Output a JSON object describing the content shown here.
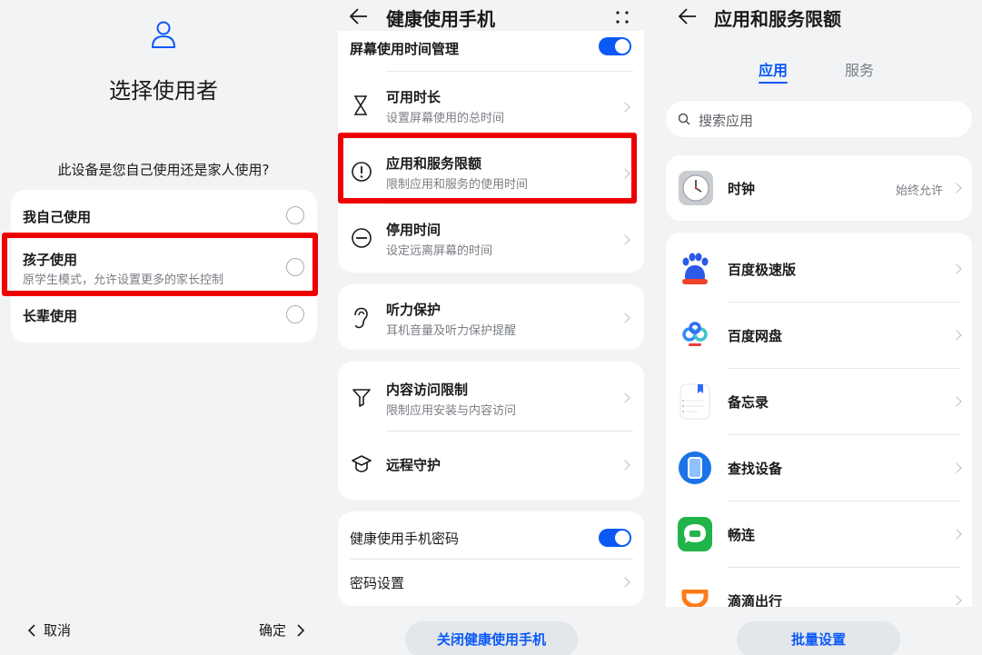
{
  "screen1": {
    "title": "选择使用者",
    "question": "此设备是您自己使用还是家人使用?",
    "options": [
      {
        "label": "我自己使用",
        "desc": ""
      },
      {
        "label": "孩子使用",
        "desc": "原学生模式，允许设置更多的家长控制"
      },
      {
        "label": "长辈使用",
        "desc": ""
      }
    ],
    "cancel_label": "取消",
    "confirm_label": "确定",
    "icons": {
      "user": "user-icon",
      "back": "chevron-left-icon",
      "forward": "chevron-right-icon"
    }
  },
  "screen2": {
    "title": "健康使用手机",
    "top_item": "屏幕使用时间管理",
    "group1": [
      {
        "title": "可用时长",
        "desc": "设置屏幕使用的总时间",
        "icon": "hourglass-icon"
      },
      {
        "title": "应用和服务限额",
        "desc": "限制应用和服务的使用时间",
        "icon": "exclamation-circle-icon"
      },
      {
        "title": "停用时间",
        "desc": "设定远离屏幕的时间",
        "icon": "minus-circle-icon"
      }
    ],
    "hearing": {
      "title": "听力保护",
      "desc": "耳机音量及听力保护提醒",
      "icon": "ear-icon"
    },
    "group3": [
      {
        "title": "内容访问限制",
        "desc": "限制应用安装与内容访问",
        "icon": "filter-icon"
      },
      {
        "title": "远程守护",
        "desc": "",
        "icon": "shield-hat-icon"
      }
    ],
    "password_toggle": "健康使用手机密码",
    "password_settings": "密码设置",
    "close_button": "关闭健康使用手机"
  },
  "screen3": {
    "title": "应用和服务限额",
    "tabs": [
      "应用",
      "服务"
    ],
    "search_placeholder": "搜索应用",
    "pinned": {
      "name": "时钟",
      "status": "始终允许",
      "icon": "clock-app-icon"
    },
    "apps": [
      {
        "name": "百度极速版",
        "icon": "baidu-lite-app-icon"
      },
      {
        "name": "百度网盘",
        "icon": "baidu-netdisk-app-icon"
      },
      {
        "name": "备忘录",
        "icon": "notes-app-icon"
      },
      {
        "name": "查找设备",
        "icon": "find-device-app-icon"
      },
      {
        "name": "畅连",
        "icon": "meetime-app-icon"
      },
      {
        "name": "滴滴出行",
        "icon": "didi-app-icon"
      }
    ],
    "batch_button": "批量设置"
  },
  "colors": {
    "accent": "#0a59f7",
    "highlight": "#ee0000",
    "background": "#f1f3f5",
    "card": "#ffffff"
  }
}
